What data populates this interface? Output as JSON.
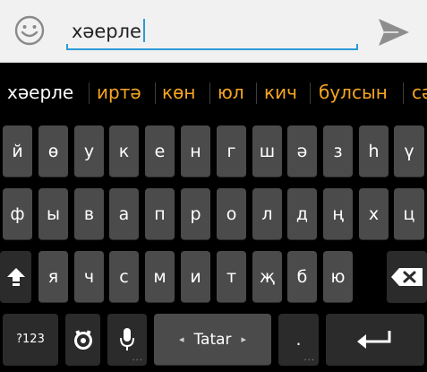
{
  "compose": {
    "input_value": "хәерле",
    "emoji_icon": "smiley-icon",
    "send_icon": "send-icon"
  },
  "suggestions": [
    {
      "text": "хәерле",
      "primary": true
    },
    {
      "text": "иртә",
      "primary": false
    },
    {
      "text": "көн",
      "primary": false
    },
    {
      "text": "юл",
      "primary": false
    },
    {
      "text": "кич",
      "primary": false
    },
    {
      "text": "булсын",
      "primary": false
    },
    {
      "text": "сәгать",
      "primary": false
    }
  ],
  "keyboard": {
    "row1": [
      "й",
      "ө",
      "у",
      "к",
      "е",
      "н",
      "г",
      "ш",
      "ә",
      "з",
      "һ",
      "ү"
    ],
    "row2": [
      "ф",
      "ы",
      "в",
      "а",
      "п",
      "р",
      "о",
      "л",
      "д",
      "ң",
      "х",
      "ц"
    ],
    "row3": [
      "я",
      "ч",
      "с",
      "м",
      "и",
      "т",
      "җ",
      "б",
      "ю"
    ],
    "symbols_label": "?123",
    "language_label": "Tatar",
    "period_label": ".",
    "lang_prev": "◂",
    "lang_next": "▸",
    "hint_dots": "..."
  },
  "colors": {
    "accent": "#2a9cd8",
    "suggestion": "#f6a623",
    "key": "#4b4b4b",
    "key_dark": "#2b2b2b"
  }
}
